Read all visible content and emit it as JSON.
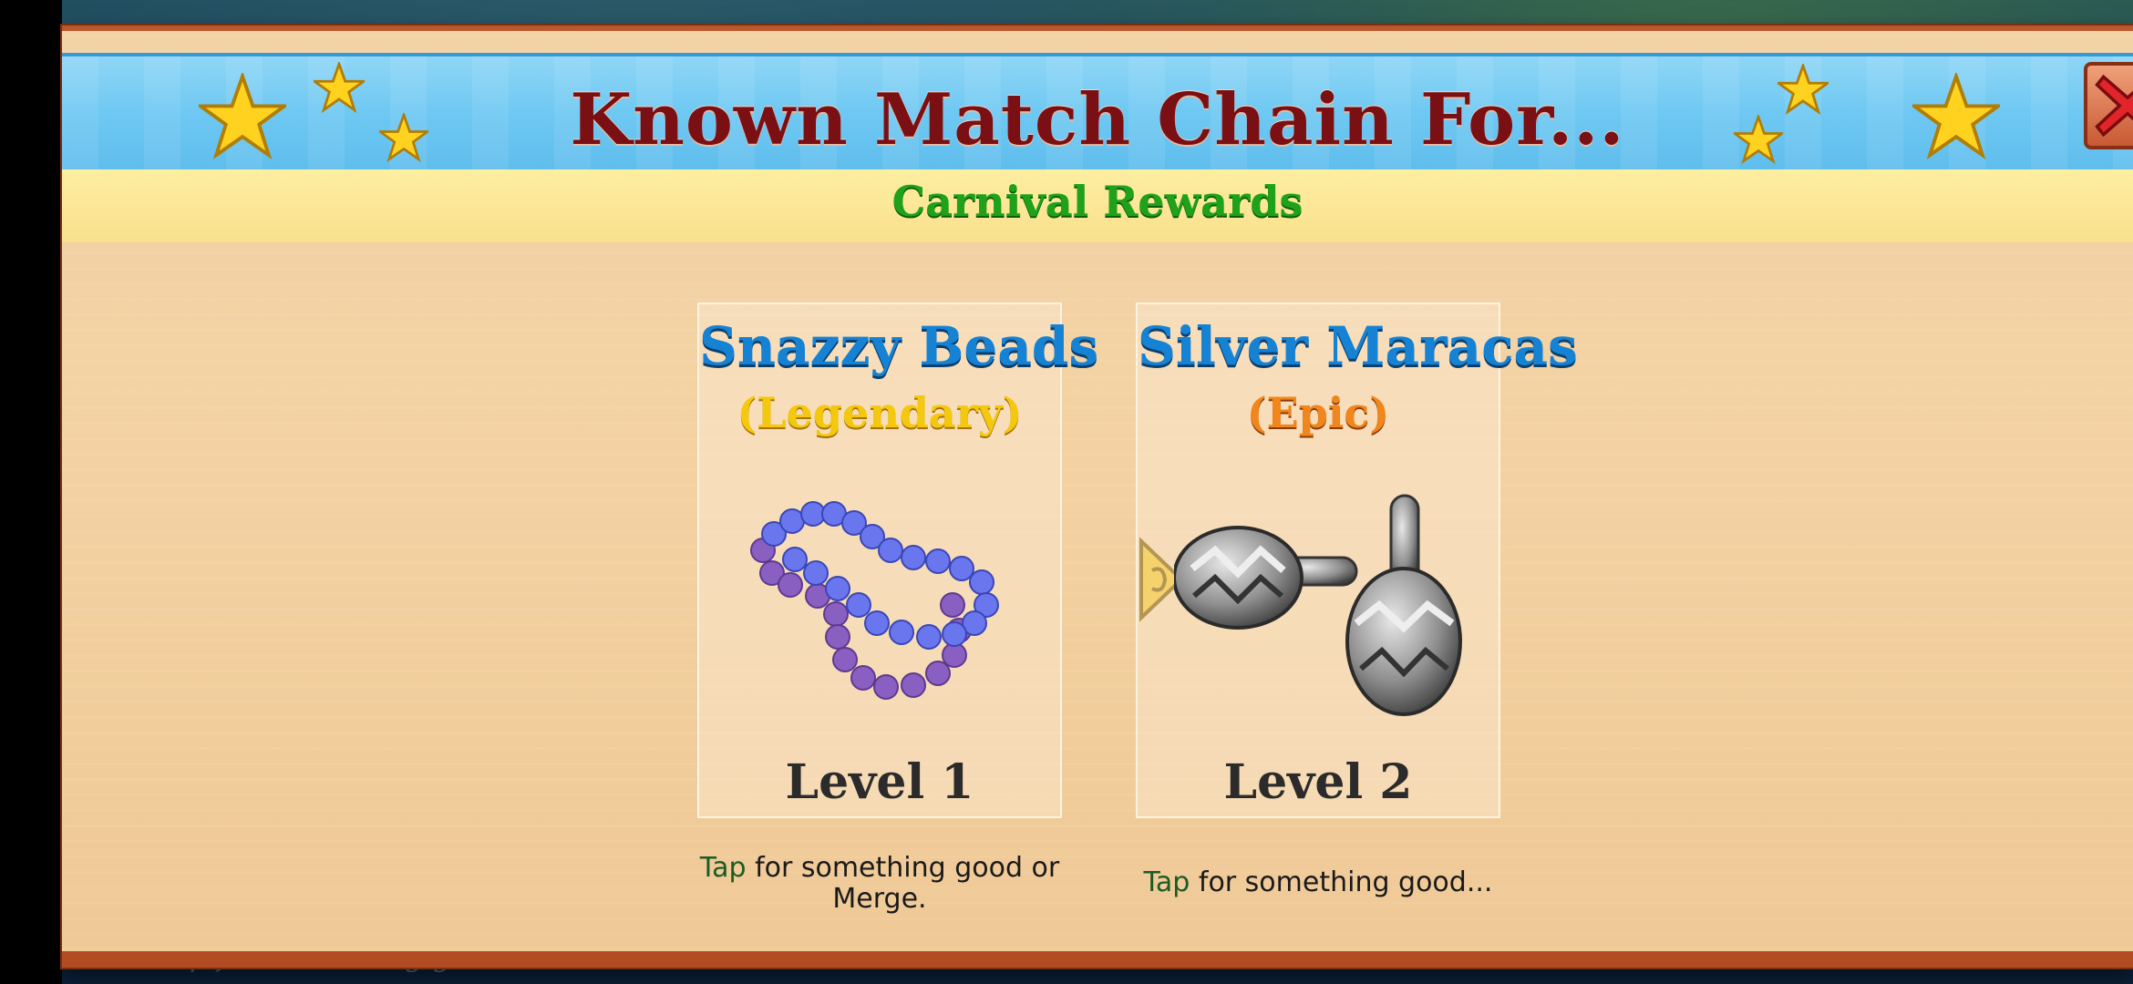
{
  "dialog": {
    "title": "Known Match Chain For...",
    "subtitle": "Carnival Rewards"
  },
  "items": [
    {
      "name": "Snazzy Beads",
      "rarity": "(Legendary)",
      "level": "Level 1",
      "tap_word": "Tap",
      "description": " for something good or Merge.",
      "icon": "beads-necklace-icon"
    },
    {
      "name": "Silver Maracas",
      "rarity": "(Epic)",
      "level": "Level 2",
      "tap_word": "Tap",
      "description": " for something good...",
      "icon": "maracas-icon"
    }
  ],
  "background_hint": "Tap for something good...",
  "colors": {
    "title": "#7a0f14",
    "subtitle": "#1fa11a",
    "item_name": "#1582d4",
    "legendary": "#f3c80d",
    "epic": "#f0861c",
    "header_blue": "#6ec8f2",
    "panel": "#f3d1a2",
    "frame": "#b24d23"
  }
}
